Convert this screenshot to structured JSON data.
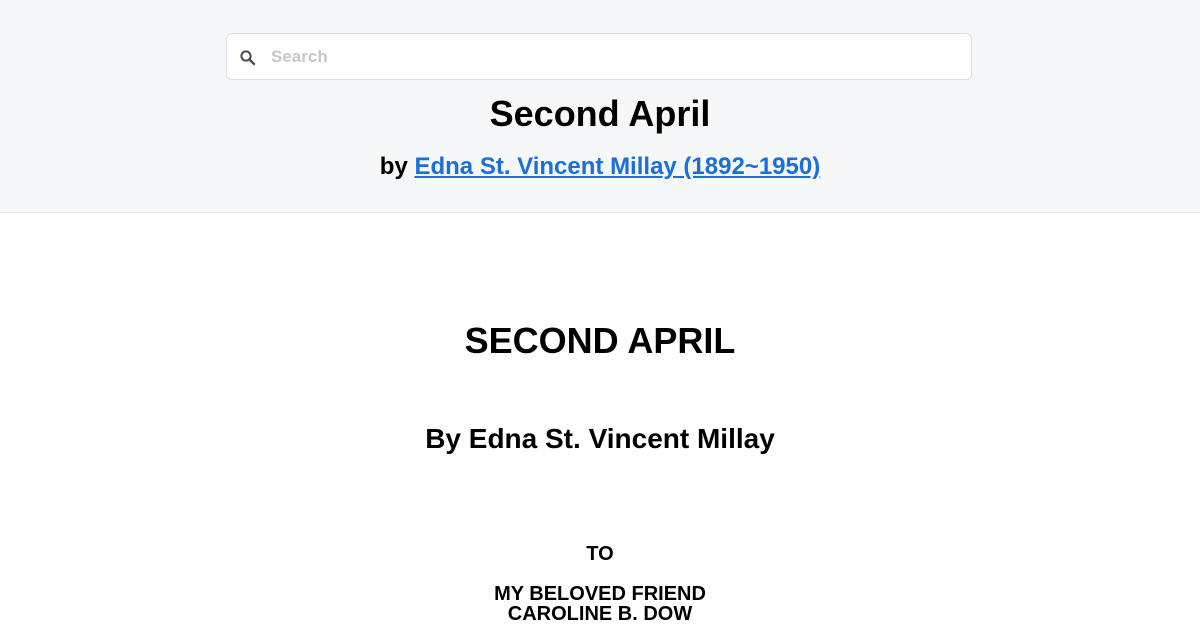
{
  "search": {
    "placeholder": "Search",
    "value": "",
    "icon": "search-icon"
  },
  "header": {
    "title": "Second April",
    "by_prefix": "by",
    "author_link": "Edna St. Vincent Millay (1892~1950)"
  },
  "content": {
    "title": "SECOND APRIL",
    "author": "By Edna St. Vincent Millay",
    "dedication": {
      "to": "TO",
      "lines": [
        "MY BELOVED FRIEND",
        "CAROLINE B. DOW"
      ]
    }
  },
  "colors": {
    "header_bg": "#f6f7f9",
    "link": "#1a6fdb",
    "text": "#000000"
  }
}
